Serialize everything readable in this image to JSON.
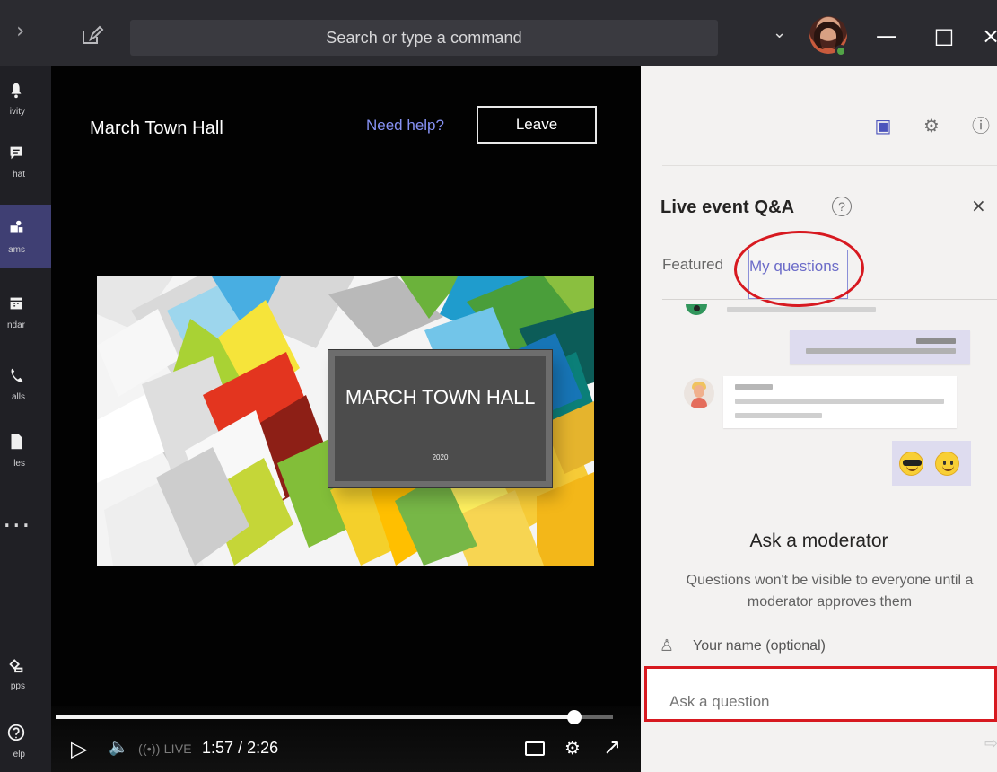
{
  "window": {
    "search_placeholder": "Search or type a command",
    "back_icon": "chevron-right-icon",
    "compose_icon": "compose-icon",
    "profile_dropdown_icon": "chevron-down-icon",
    "minimize_icon": "minimize-icon",
    "maximize_icon": "maximize-icon",
    "close_icon": "close-icon",
    "presence_color": "#52a447"
  },
  "sidebar": {
    "items": [
      {
        "label": "Activity",
        "visible_label": "ivity",
        "icon": "bell-icon"
      },
      {
        "label": "Chat",
        "visible_label": "hat",
        "icon": "chat-icon"
      },
      {
        "label": "Teams",
        "visible_label": "ams",
        "icon": "teams-icon",
        "active": true
      },
      {
        "label": "Calendar",
        "visible_label": "ndar",
        "icon": "calendar-icon"
      },
      {
        "label": "Calls",
        "visible_label": "alls",
        "icon": "call-icon"
      },
      {
        "label": "Files",
        "visible_label": "les",
        "icon": "file-icon"
      },
      {
        "label": "Apps",
        "visible_label": "pps",
        "icon": "apps-icon"
      },
      {
        "label": "Help",
        "visible_label": "elp",
        "icon": "help-icon"
      }
    ],
    "more_glyph": "..."
  },
  "player": {
    "title": "March Town Hall",
    "help_link": "Need help?",
    "leave_button": "Leave",
    "slide": {
      "title": "MARCH TOWN HALL",
      "year": "2020"
    },
    "controls": {
      "progress": 0.93,
      "play_icon": "play-icon",
      "volume_icon": "volume-icon",
      "live_icon": "live-broadcast-icon",
      "live_label": "LIVE",
      "current_time": "1:57",
      "duration": "2:26",
      "captions_icon": "captions-icon",
      "settings_icon": "gear-icon",
      "fullscreen_icon": "fullscreen-icon"
    }
  },
  "panel": {
    "top_icons": [
      "qa-icon",
      "gear-icon",
      "info-icon"
    ],
    "title": "Live event Q&A",
    "help_icon": "question-icon",
    "close_icon": "close-icon",
    "tabs": [
      {
        "label": "Featured",
        "selected": false
      },
      {
        "label": "My questions",
        "selected": true
      }
    ],
    "ask_title": "Ask a moderator",
    "ask_note": "Questions won't be visible to everyone until a moderator approves them",
    "name_field": "Your name (optional)",
    "question_placeholder": "Ask a question",
    "send_icon": "send-icon",
    "annotation_color": "#d71920"
  }
}
